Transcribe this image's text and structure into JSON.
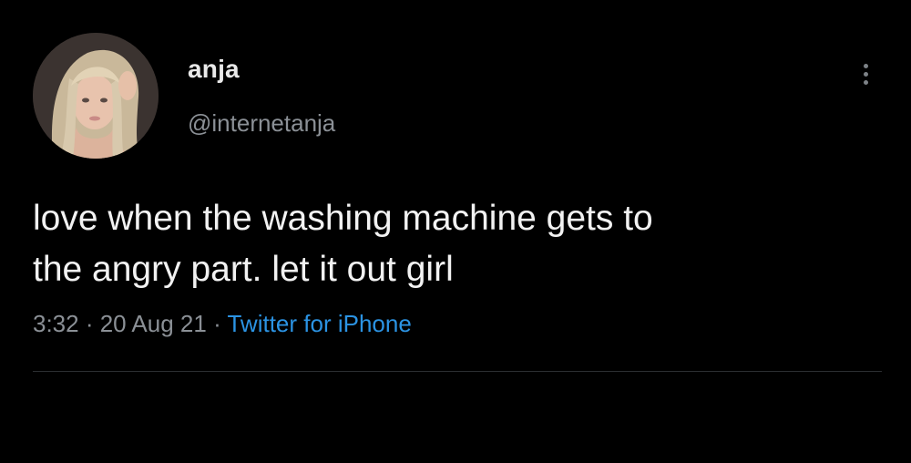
{
  "author": {
    "display_name": "anja",
    "handle": "@internetanja",
    "avatar_icon": "profile-photo"
  },
  "tweet": {
    "text_lines": [
      "love when the washing machine gets to",
      "the angry part. let it out girl"
    ],
    "time": "3:32",
    "separator": " · ",
    "date": "20 Aug 21",
    "source": "Twitter for iPhone"
  },
  "menu": {
    "icon": "more-vertical-icon"
  },
  "colors": {
    "background": "#000000",
    "primary_text": "#f2f2f2",
    "secondary_text": "#8b9096",
    "link": "#2b93e3",
    "divider": "#2b2e31"
  }
}
